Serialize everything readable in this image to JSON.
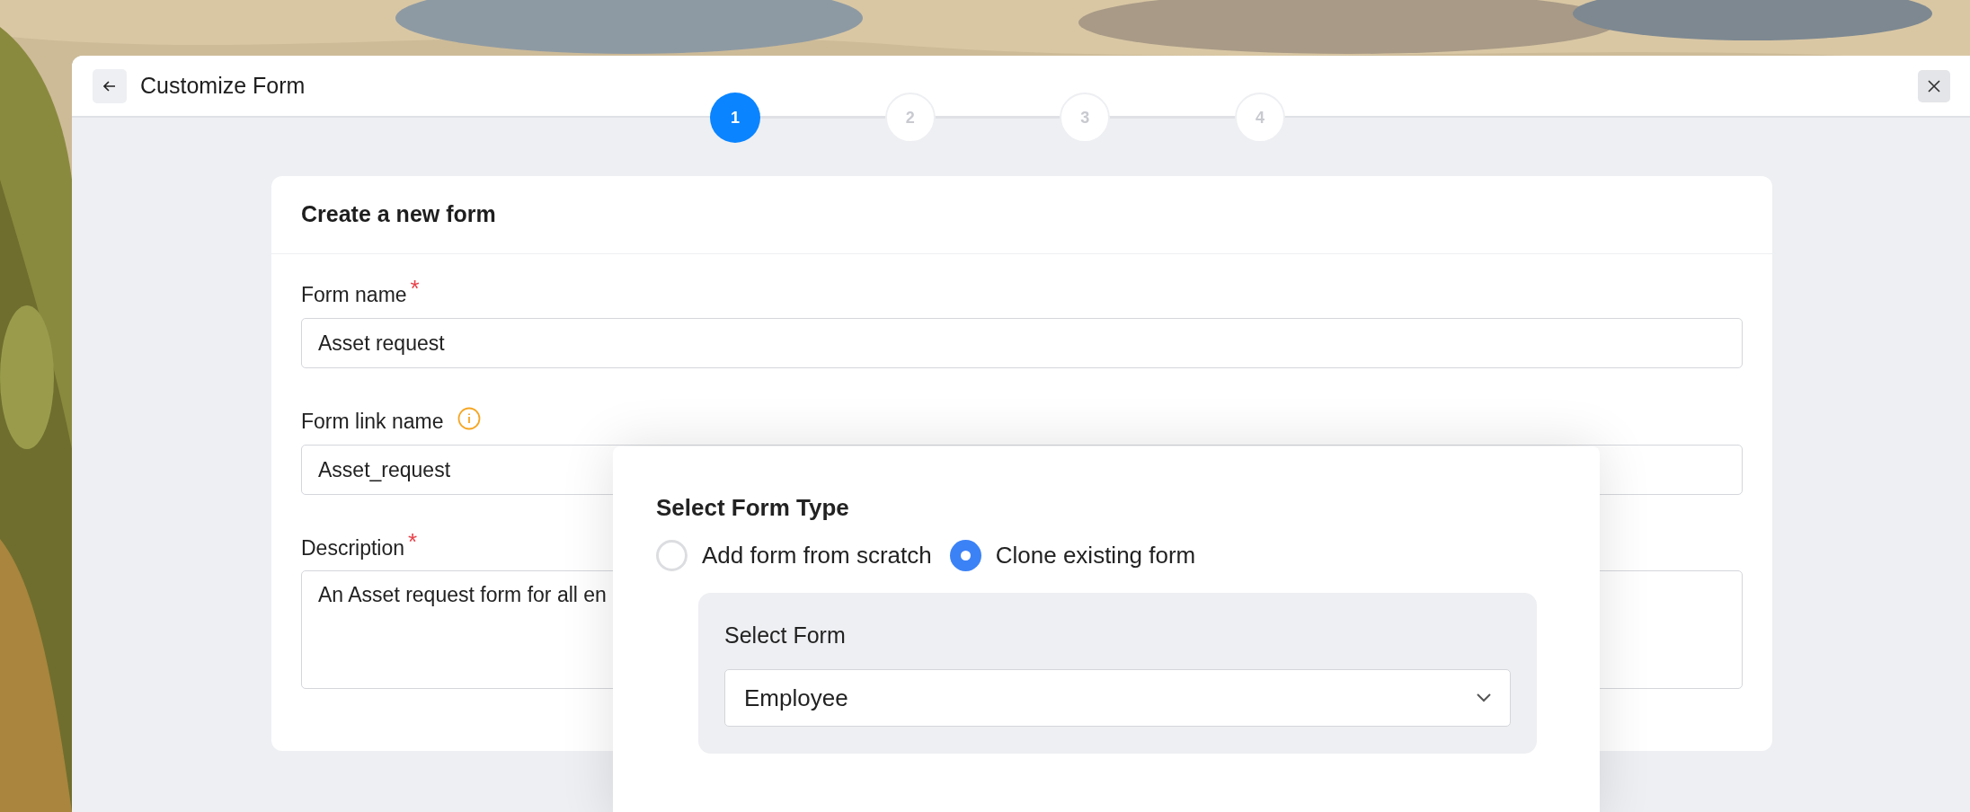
{
  "window": {
    "title": "Customize Form"
  },
  "steps": [
    {
      "label": "1",
      "selected": true
    },
    {
      "label": "2",
      "selected": false
    },
    {
      "label": "3",
      "selected": false
    },
    {
      "label": "4",
      "selected": false
    }
  ],
  "card": {
    "title": "Create a new form",
    "fields": [
      {
        "kind": "input",
        "label": "Form name",
        "required_mark": "*",
        "info": false,
        "value": "Asset request"
      },
      {
        "kind": "input",
        "label": "Form link name",
        "info": true,
        "value": "Asset_request"
      },
      {
        "kind": "textarea",
        "label": "Description",
        "required_mark": "*",
        "info": false,
        "value": "An Asset request form for all en"
      }
    ]
  },
  "popup": {
    "title": "Select Form Type",
    "options": [
      {
        "label": "Add form from scratch",
        "selected": false
      },
      {
        "label": "Clone existing form",
        "selected": true
      }
    ],
    "select_label": "Select Form",
    "select_value": "Employee"
  }
}
